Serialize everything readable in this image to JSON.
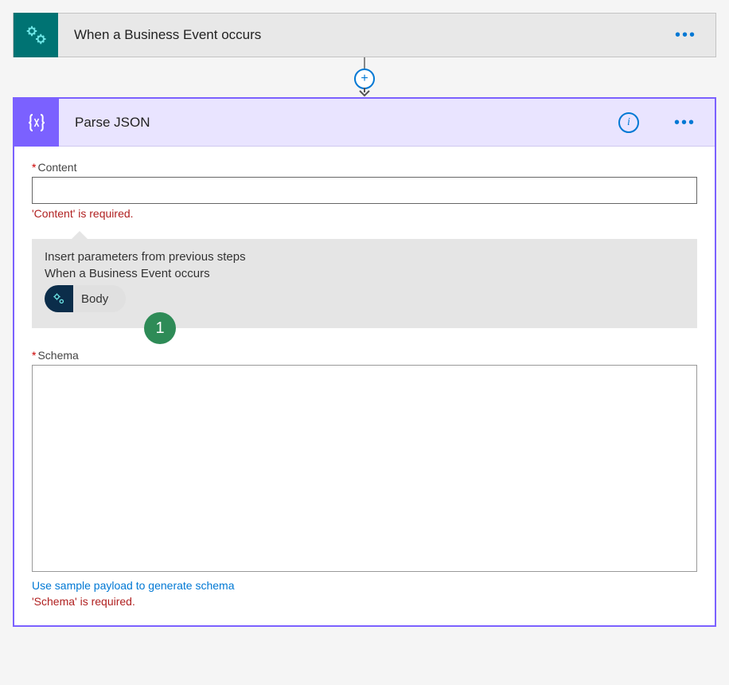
{
  "trigger": {
    "title": "When a Business Event occurs"
  },
  "action": {
    "title": "Parse JSON",
    "content": {
      "label": "Content",
      "value": "",
      "error": "'Content' is required."
    },
    "params": {
      "title": "Insert parameters from previous steps",
      "source": "When a Business Event occurs",
      "chip_label": "Body",
      "annotation": "1"
    },
    "schema": {
      "label": "Schema",
      "value": "",
      "link": "Use sample payload to generate schema",
      "error": "'Schema' is required."
    }
  }
}
